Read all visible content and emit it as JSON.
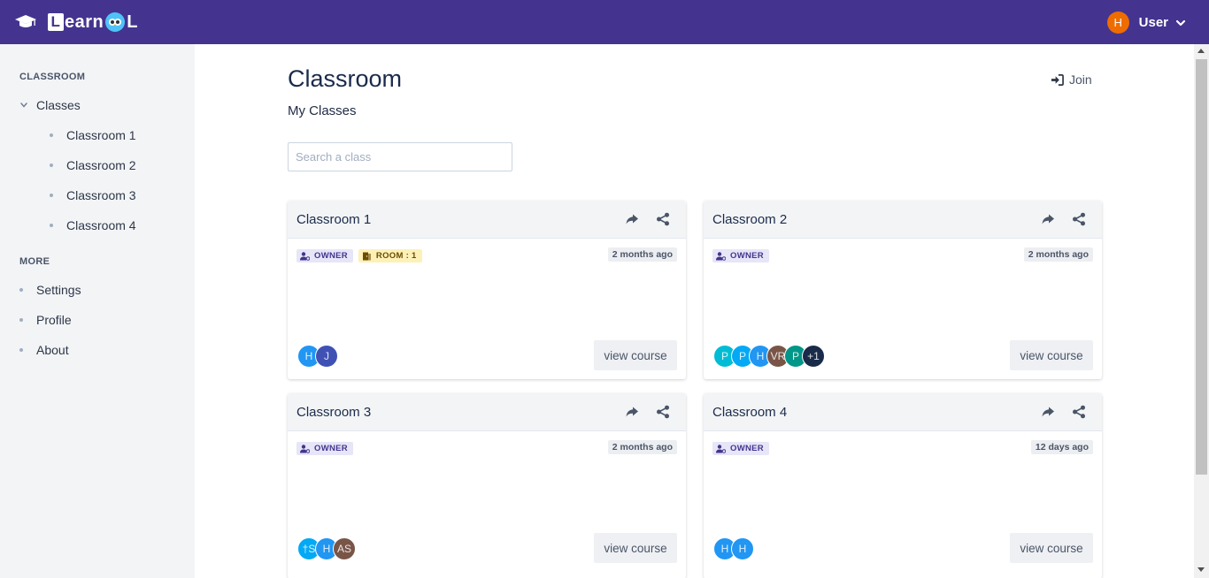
{
  "app": {
    "brand": {
      "prefix": "L",
      "mid": "earn",
      "suffix": "L"
    },
    "user": {
      "initial": "H",
      "name": "User"
    },
    "colors": {
      "topbar": "#44348f",
      "sidebar": "#f3f4f6",
      "avatar_user": "#ef6c00"
    }
  },
  "sidebar": {
    "section1": "CLASSROOM",
    "group_label": "Classes",
    "classes": [
      "Classroom 1",
      "Classroom 2",
      "Classroom 3",
      "Classroom 4"
    ],
    "section2": "MORE",
    "more": [
      "Settings",
      "Profile",
      "About"
    ]
  },
  "main": {
    "title": "Classroom",
    "subtitle": "My Classes",
    "join_label": "Join",
    "search_placeholder": "Search a class"
  },
  "cards": [
    {
      "title": "Classroom 1",
      "badges": [
        {
          "type": "owner",
          "label": "OWNER"
        },
        {
          "type": "room",
          "label": "ROOM : 1"
        }
      ],
      "time": "2 months ago",
      "avatars": [
        {
          "t": "H",
          "c": "#2196f3"
        },
        {
          "t": "J",
          "c": "#3f51b5"
        }
      ],
      "button": "view course"
    },
    {
      "title": "Classroom 2",
      "badges": [
        {
          "type": "owner",
          "label": "OWNER"
        }
      ],
      "time": "2 months ago",
      "avatars": [
        {
          "t": "P",
          "c": "#00bcd4"
        },
        {
          "t": "P",
          "c": "#03a9f4"
        },
        {
          "t": "H",
          "c": "#2196f3"
        },
        {
          "t": "VR",
          "c": "#795548"
        },
        {
          "t": "P",
          "c": "#009688"
        },
        {
          "t": "+1",
          "c": "#1a2b4a"
        }
      ],
      "button": "view course"
    },
    {
      "title": "Classroom 3",
      "badges": [
        {
          "type": "owner",
          "label": "OWNER"
        }
      ],
      "time": "2 months ago",
      "avatars": [
        {
          "t": "†S",
          "c": "#03a9f4"
        },
        {
          "t": "H",
          "c": "#2196f3"
        },
        {
          "t": "AS",
          "c": "#795548"
        }
      ],
      "button": "view course"
    },
    {
      "title": "Classroom 4",
      "badges": [
        {
          "type": "owner",
          "label": "OWNER"
        }
      ],
      "time": "12 days ago",
      "avatars": [
        {
          "t": "H",
          "c": "#2196f3"
        },
        {
          "t": "H",
          "c": "#2196f3"
        }
      ],
      "button": "view course"
    }
  ]
}
